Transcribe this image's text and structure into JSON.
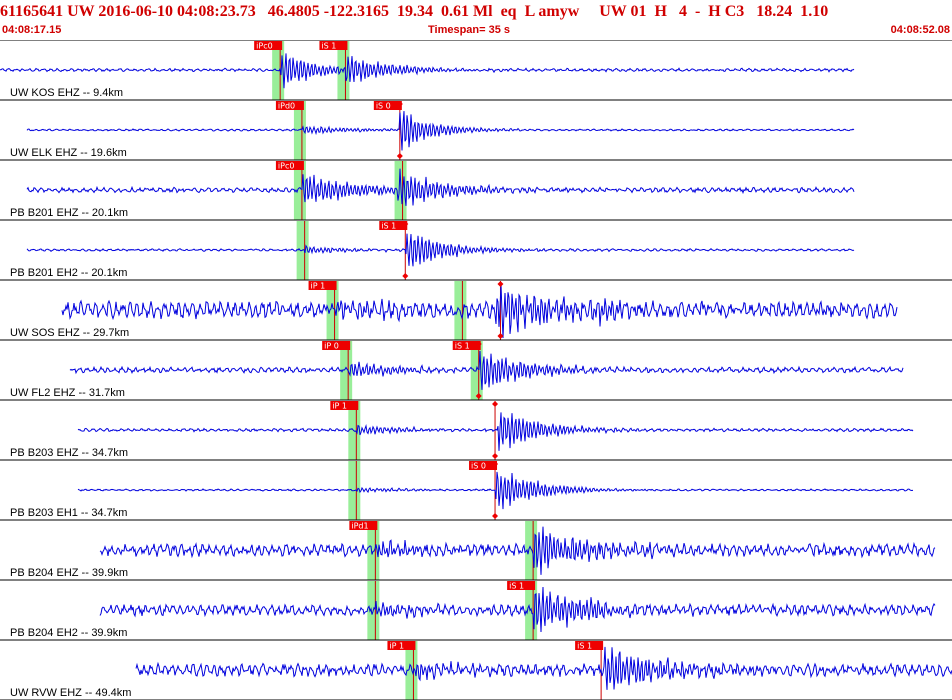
{
  "header": {
    "title": "61165641 UW 2016-06-10 04:08:23.73   46.4805 -122.3165  19.34  0.61 Ml  eq  L amyw     UW 01  H   4  -  H C3   18.24  1.10",
    "start_time": "04:08:17.15",
    "timespan": "Timespan=  35 s",
    "end_time": "04:08:52.08"
  },
  "colors": {
    "header_text": "#d00000",
    "trace": "#0000dd",
    "pick_flag": "#ee0000",
    "pick_window": "#99ee99",
    "pick_line": "#cc0000",
    "separator": "#000000"
  },
  "chart_data": {
    "type": "line",
    "title": "61165641 UW 2016-06-10 04:08:23.73   46.4805 -122.3165  19.34  0.61 Ml  eq  L amyw     UW 01  H   4  -  H C3   18.24  1.10",
    "x_range_seconds": [
      0,
      35
    ],
    "channels": [
      {
        "label": "UW KOS EHZ -- 9.4km",
        "data_start": 0.0,
        "data_end": 31.4,
        "noise": 0.05,
        "picks": [
          {
            "text": "iPc0",
            "t": 10.3,
            "win": true,
            "diamond": false
          },
          {
            "text": "iS 1",
            "t": 12.7,
            "win": true,
            "diamond": false
          }
        ],
        "bursts": [
          {
            "t": 10.3,
            "amp": 0.7,
            "decay": 1.4
          },
          {
            "t": 12.7,
            "amp": 0.5,
            "decay": 1.6
          }
        ]
      },
      {
        "label": "UW ELK EHZ -- 19.6km",
        "data_start": 1.0,
        "data_end": 31.4,
        "noise": 0.03,
        "picks": [
          {
            "text": "iPd0",
            "t": 11.1,
            "win": true,
            "diamond": false
          },
          {
            "text": "iS 0",
            "t": 14.7,
            "win": false,
            "diamond": true
          }
        ],
        "bursts": [
          {
            "t": 11.1,
            "amp": 0.15,
            "decay": 1.8
          },
          {
            "t": 14.7,
            "amp": 0.8,
            "decay": 1.2
          }
        ]
      },
      {
        "label": "PB B201 EHZ -- 20.1km",
        "data_start": 1.0,
        "data_end": 31.4,
        "noise": 0.08,
        "picks": [
          {
            "text": "iPc0",
            "t": 11.1,
            "win": true,
            "diamond": false
          },
          {
            "text": "",
            "t": 14.8,
            "win": true,
            "diamond": false
          }
        ],
        "bursts": [
          {
            "t": 11.1,
            "amp": 0.6,
            "decay": 2.0
          },
          {
            "t": 14.6,
            "amp": 0.8,
            "decay": 1.6
          }
        ]
      },
      {
        "label": "PB B201 EH2 -- 20.1km",
        "data_start": 1.0,
        "data_end": 31.4,
        "noise": 0.04,
        "picks": [
          {
            "text": "",
            "t": 11.2,
            "win": true,
            "diamond": false
          },
          {
            "text": "iS 1",
            "t": 14.9,
            "win": false,
            "diamond": true
          }
        ],
        "bursts": [
          {
            "t": 11.2,
            "amp": 0.15,
            "decay": 1.6
          },
          {
            "t": 14.9,
            "amp": 0.8,
            "decay": 1.4
          }
        ]
      },
      {
        "label": "UW SOS EHZ -- 29.7km",
        "data_start": 2.3,
        "data_end": 33.0,
        "noise": 0.28,
        "picks": [
          {
            "text": "iP 1",
            "t": 12.3,
            "win": true,
            "diamond": false
          },
          {
            "text": "",
            "t": 17.0,
            "win": true,
            "diamond": false
          },
          {
            "text": "",
            "t": 18.4,
            "win": false,
            "diamond": true
          }
        ],
        "bursts": [
          {
            "t": 12.3,
            "amp": 0.3,
            "decay": 1.8
          },
          {
            "t": 18.2,
            "amp": 0.9,
            "decay": 2.2
          },
          {
            "t": 21.7,
            "amp": 0.5,
            "decay": 1.3
          }
        ]
      },
      {
        "label": "UW FL2 EHZ -- 31.7km",
        "data_start": 2.6,
        "data_end": 33.2,
        "noise": 0.09,
        "picks": [
          {
            "text": "iP 0",
            "t": 12.8,
            "win": true,
            "diamond": false
          },
          {
            "text": "iS 1",
            "t": 17.6,
            "win": true,
            "diamond": true
          }
        ],
        "bursts": [
          {
            "t": 12.8,
            "amp": 0.3,
            "decay": 1.8
          },
          {
            "t": 17.6,
            "amp": 0.8,
            "decay": 1.6
          }
        ]
      },
      {
        "label": "PB B203 EHZ -- 34.7km",
        "data_start": 2.9,
        "data_end": 33.6,
        "noise": 0.05,
        "picks": [
          {
            "text": "iP 1",
            "t": 13.1,
            "win": true,
            "diamond": false
          },
          {
            "text": "",
            "t": 18.2,
            "win": false,
            "diamond": true
          }
        ],
        "bursts": [
          {
            "t": 13.1,
            "amp": 0.2,
            "decay": 1.6
          },
          {
            "t": 18.3,
            "amp": 0.8,
            "decay": 1.6
          }
        ]
      },
      {
        "label": "PB B203 EH1 -- 34.7km",
        "data_start": 2.9,
        "data_end": 33.6,
        "noise": 0.03,
        "picks": [
          {
            "text": "",
            "t": 13.1,
            "win": true,
            "diamond": false
          },
          {
            "text": "iS 0",
            "t": 18.2,
            "win": false,
            "diamond": true
          }
        ],
        "bursts": [
          {
            "t": 13.1,
            "amp": 0.1,
            "decay": 1.6
          },
          {
            "t": 18.2,
            "amp": 0.9,
            "decay": 1.4
          }
        ]
      },
      {
        "label": "PB B204 EHZ -- 39.9km",
        "data_start": 3.7,
        "data_end": 34.4,
        "noise": 0.2,
        "picks": [
          {
            "text": "iPd1",
            "t": 13.8,
            "win": true,
            "diamond": false
          },
          {
            "text": "",
            "t": 19.6,
            "win": true,
            "diamond": false
          }
        ],
        "bursts": [
          {
            "t": 13.8,
            "amp": 0.3,
            "decay": 1.8
          },
          {
            "t": 19.6,
            "amp": 0.9,
            "decay": 2.0
          }
        ]
      },
      {
        "label": "PB B204 EH2 -- 39.9km",
        "data_start": 3.7,
        "data_end": 34.4,
        "noise": 0.18,
        "picks": [
          {
            "text": "",
            "t": 13.8,
            "win": true,
            "diamond": false
          },
          {
            "text": "iS 1",
            "t": 19.6,
            "win": true,
            "diamond": false
          }
        ],
        "bursts": [
          {
            "t": 13.8,
            "amp": 0.25,
            "decay": 1.8
          },
          {
            "t": 19.6,
            "amp": 0.9,
            "decay": 2.0
          }
        ]
      },
      {
        "label": "UW RVW EHZ -- 49.4km",
        "data_start": 5.0,
        "data_end": 35.0,
        "noise": 0.2,
        "picks": [
          {
            "text": "iP 1",
            "t": 15.2,
            "win": true,
            "diamond": false
          },
          {
            "text": "iS 1",
            "t": 22.1,
            "win": false,
            "diamond": false
          }
        ],
        "bursts": [
          {
            "t": 15.2,
            "amp": 0.3,
            "decay": 1.8
          },
          {
            "t": 22.2,
            "amp": 0.9,
            "decay": 2.0
          }
        ]
      }
    ]
  }
}
